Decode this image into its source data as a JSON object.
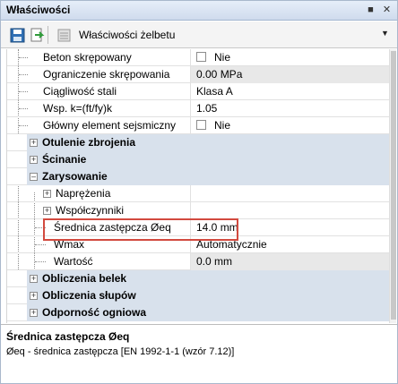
{
  "panel": {
    "title": "Właściwości"
  },
  "toolbar": {
    "save_icon": "save-icon",
    "export_icon": "export-icon",
    "properties_icon": "properties-icon",
    "label": "Właściwości żelbetu"
  },
  "rows": {
    "beton_label": "Beton skrępowany",
    "beton_value": "Nie",
    "ograniczenie_label": "Ograniczenie skrępowania",
    "ograniczenie_value": "0.00 MPa",
    "ciagliwosc_label": "Ciągliwość stali",
    "ciagliwosc_value": "Klasa A",
    "wsp_label": "Wsp. k=(ft/fy)k",
    "wsp_value": "1.05",
    "glowny_label": "Główny element sejsmiczny",
    "glowny_value": "Nie",
    "otulenie": "Otulenie zbrojenia",
    "scinanie": "Ścinanie",
    "zarysowanie": "Zarysowanie",
    "naprezenia": "Naprężenia",
    "wspolczynniki": "Współczynniki",
    "srednica_label": "Średnica zastępcza Øeq",
    "srednica_value": "14.0 mm",
    "wmax_label": "Wmax",
    "wmax_value": "Automatycznie",
    "wartosc_label": "Wartość",
    "wartosc_value": "0.0 mm",
    "belek": "Obliczenia belek",
    "slupow": "Obliczenia słupów",
    "odpornosc": "Odporność ogniowa"
  },
  "help": {
    "title": "Średnica zastępcza Øeq",
    "description": "Øeq - średnica zastępcza [EN 1992-1-1 (wzór 7.12)]"
  }
}
